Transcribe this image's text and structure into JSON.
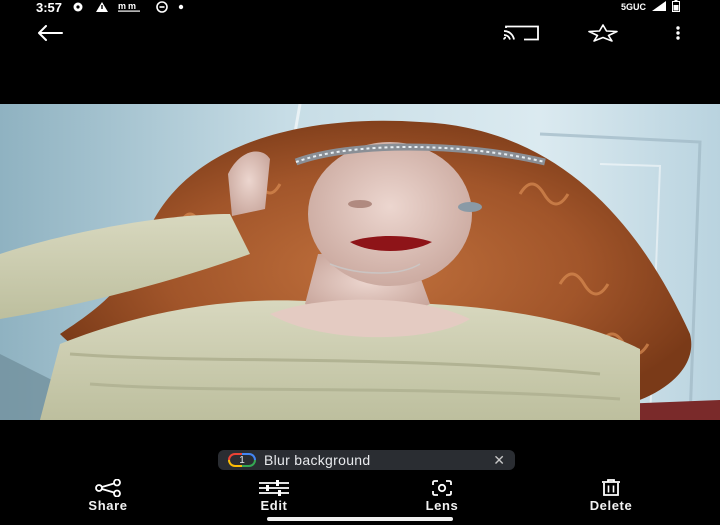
{
  "status_bar": {
    "time": "3:57",
    "notification_icons": [
      "settings-gear-icon",
      "warning-icon",
      "amazon-music-icon",
      "sync-icon",
      "dot-icon"
    ],
    "network": "5GUC"
  },
  "top_bar": {
    "back_icon": "arrow-left-icon",
    "cast_icon": "cast-icon",
    "favorite_icon": "star-outline-icon",
    "menu_icon": "more-vert-icon"
  },
  "photo": {
    "subject": "portrait"
  },
  "suggestion_chip": {
    "badge": "1",
    "label": "Blur background",
    "close": "✕"
  },
  "actions": [
    {
      "label": "Share",
      "icon": "share-icon"
    },
    {
      "label": "Edit",
      "icon": "sliders-icon"
    },
    {
      "label": "Lens",
      "icon": "lens-icon"
    },
    {
      "label": "Delete",
      "icon": "trash-icon"
    }
  ],
  "colors": {
    "background": "#000000",
    "chip_bg": "#2a2d32",
    "text": "#ffffff"
  }
}
